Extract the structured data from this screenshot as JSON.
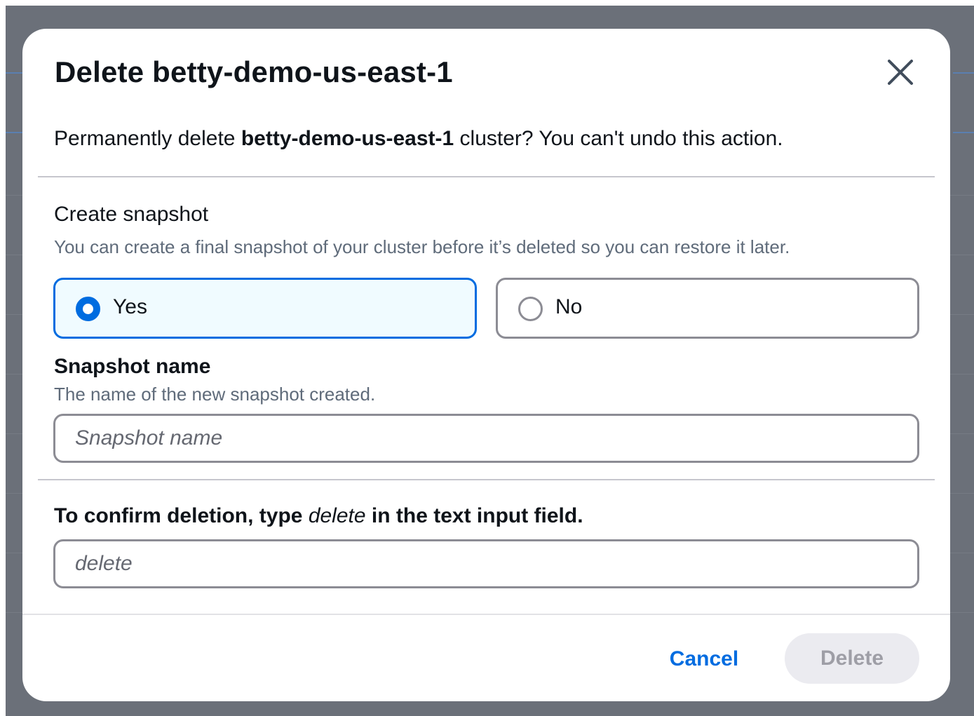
{
  "modal": {
    "title": "Delete betty-demo-us-east-1",
    "confirm_prefix": "Permanently delete ",
    "cluster_name": "betty-demo-us-east-1",
    "confirm_suffix": " cluster? You can't undo this action."
  },
  "snapshot": {
    "title": "Create snapshot",
    "description": "You can create a final snapshot of your cluster before it’s deleted so you can restore it later.",
    "options": [
      {
        "label": "Yes",
        "selected": true
      },
      {
        "label": "No",
        "selected": false
      }
    ],
    "name_label": "Snapshot name",
    "name_description": "The name of the new snapshot created.",
    "name_placeholder": "Snapshot name",
    "name_value": ""
  },
  "confirm": {
    "label_prefix": "To confirm deletion, type ",
    "label_keyword": "delete",
    "label_suffix": " in the text input field.",
    "placeholder": "delete",
    "value": ""
  },
  "footer": {
    "cancel_label": "Cancel",
    "delete_label": "Delete"
  },
  "colors": {
    "accent": "#006ce0",
    "disabled_bg": "#ebebf0",
    "disabled_text": "#9e9ea6",
    "overlay": "#6b7079"
  }
}
